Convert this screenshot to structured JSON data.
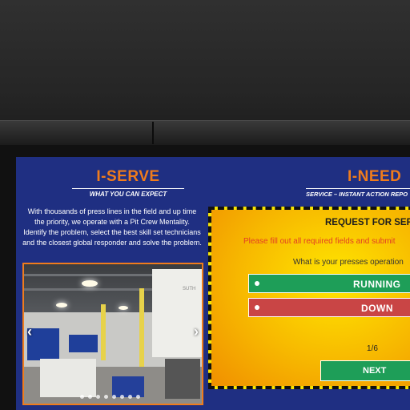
{
  "left": {
    "title": "I-SERVE",
    "subtitle": "WHAT YOU CAN EXPECT",
    "body": "With thousands of press lines in the field and up time the priority, we operate with a Pit Crew Mentality. Identify the problem, select the best skill set technicians and the closest global responder and solve the problem.",
    "photo_sign": "SUTH"
  },
  "right": {
    "title": "I-NEED",
    "subtitle": "SERVICE – INSTANT ACTION REPO",
    "form": {
      "title": "REQUEST FOR SERVI",
      "note": "Please fill out all required fields and submit",
      "question": "What is your presses operation",
      "options": [
        "RUNNING",
        "DOWN"
      ],
      "page": "1/6",
      "next_label": "NEXT"
    }
  },
  "colors": {
    "screen_bg": "#1f2f82",
    "accent_orange": "#f07c1c",
    "running_green": "#1e9e58",
    "down_red": "#c94545",
    "panel_yellow": "#ffe600"
  }
}
